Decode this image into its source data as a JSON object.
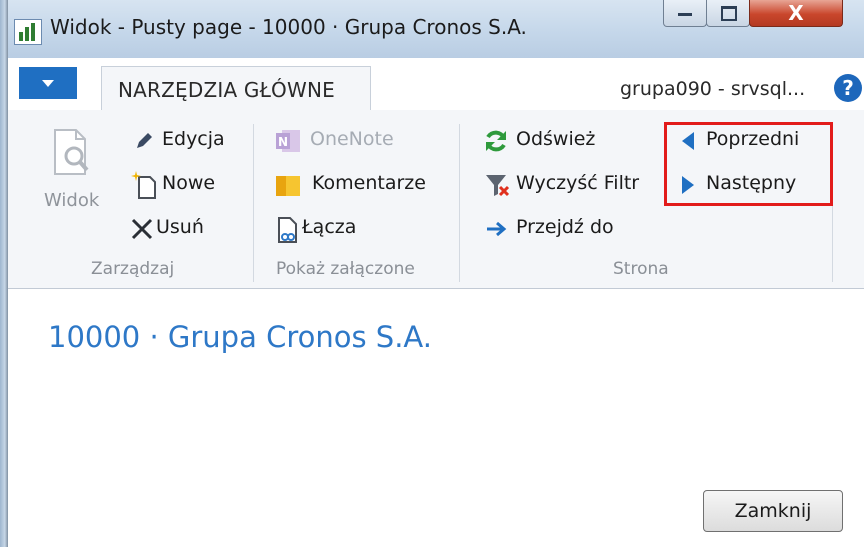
{
  "window": {
    "title": "Widok - Pusty page - 10000 · Grupa Cronos S.A.",
    "close_glyph": "X"
  },
  "ribbon": {
    "active_tab": "NARZĘDZIA GŁÓWNE",
    "server_label": "grupa090 - srvsql...",
    "help_glyph": "?",
    "groups": {
      "manage": {
        "label": "Zarządzaj",
        "view_label": "Widok",
        "edit_label": "Edycja",
        "new_label": "Nowe",
        "delete_label": "Usuń"
      },
      "attachments": {
        "label": "Pokaż załączone",
        "onenote_label": "OneNote",
        "notes_label": "Komentarze",
        "links_label": "Łącza"
      },
      "page": {
        "label": "Strona",
        "refresh_label": "Odśwież",
        "clear_filter_label": "Wyczyść Filtr",
        "goto_label": "Przejdź do",
        "previous_label": "Poprzedni",
        "next_label": "Następny"
      }
    }
  },
  "content": {
    "record_title": "10000 · Grupa Cronos S.A.",
    "close_button": "Zamknij"
  },
  "colors": {
    "accent_blue": "#1f6fc2",
    "title_blue": "#2e78c7",
    "highlight_red": "#e21b1b",
    "refresh_green": "#2e9a3c"
  }
}
